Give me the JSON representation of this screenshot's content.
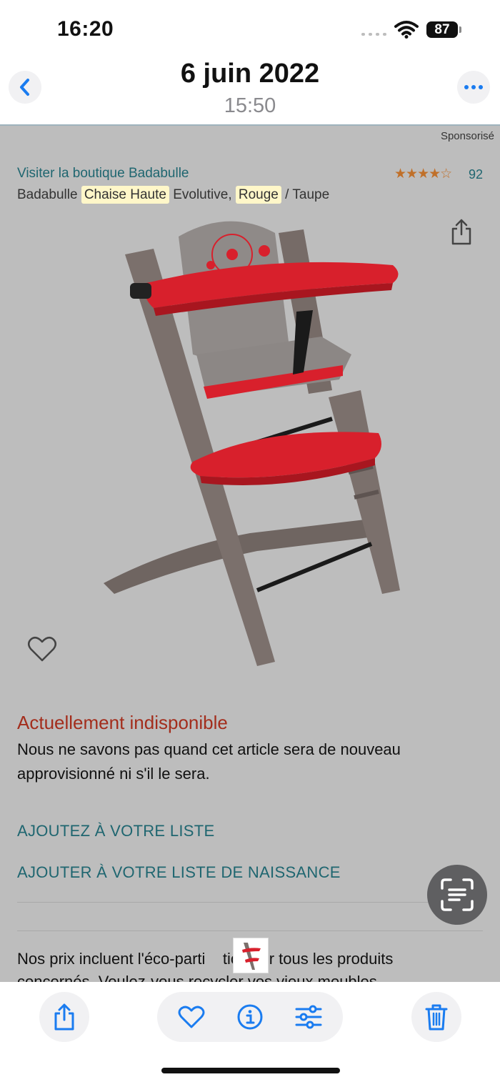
{
  "status_bar": {
    "time": "16:20",
    "battery": "87"
  },
  "header": {
    "date": "6 juin 2022",
    "time": "15:50"
  },
  "photo": {
    "sponsored": "Sponsorisé",
    "shop_link": "Visiter la boutique Badabulle",
    "rating_stars": "★★★★☆",
    "rating_count": "92",
    "title": {
      "brand": "Badabulle",
      "highlight1": "Chaise Haute",
      "middle": "Evolutive,",
      "highlight2": "Rouge",
      "end": "/ Taupe"
    },
    "unavailable_title": "Actuellement indisponible",
    "unavailable_text": "Nous ne savons pas quand cet article sera de nouveau approvisionné ni s'il le sera.",
    "add_to_list": "AJOUTEZ À VOTRE LISTE",
    "add_to_birth_list": "AJOUTER À VOTRE LISTE DE NAISSANCE",
    "eco_line1": "Nos prix incluent l'éco-parti    tion sur tous les produits",
    "eco_line2": "concernés. Voulez-vous recycler vos vieux meubles"
  },
  "colors": {
    "accent_blue": "#1a7cf0",
    "link_teal": "#1f6670",
    "unavailable_red": "#a32d1c",
    "chair_red": "#d8202c",
    "chair_gray": "#7b706c"
  },
  "icons": {
    "back": "chevron-left-icon",
    "more": "ellipsis-icon",
    "share": "share-icon",
    "favorite": "heart-icon",
    "info": "info-icon",
    "adjust": "sliders-icon",
    "delete": "trash-icon",
    "live_text": "live-text-icon"
  }
}
